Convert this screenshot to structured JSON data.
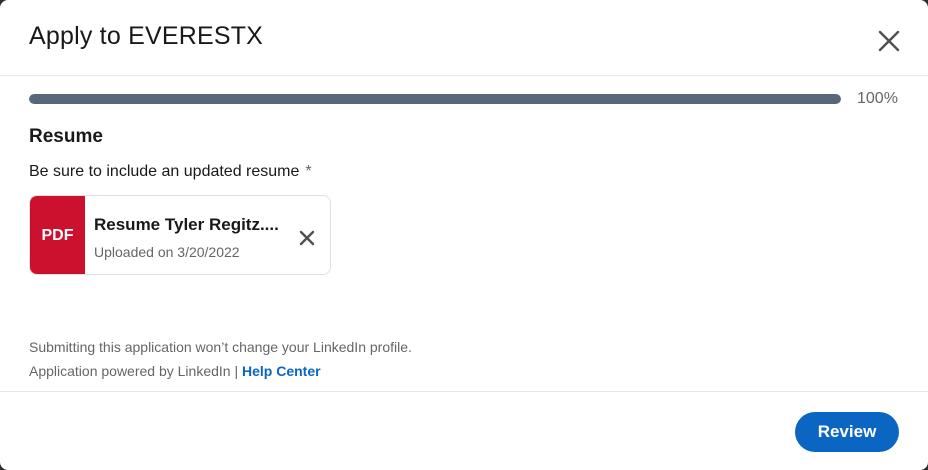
{
  "dialog": {
    "title": "Apply to EVERESTX"
  },
  "progress": {
    "value": 1.0,
    "label": "100%"
  },
  "section": {
    "title": "Resume",
    "field_label": "Be sure to include an updated resume",
    "required_marker": "*"
  },
  "file": {
    "badge": "PDF",
    "name": "Resume Tyler Regitz....",
    "meta": "Uploaded on 3/20/2022"
  },
  "footer": {
    "note": "Submitting this application won’t change your LinkedIn profile.",
    "powered_by": "Application powered by LinkedIn",
    "separator": "|",
    "help_link": "Help Center",
    "review_label": "Review"
  },
  "icons": {
    "close": "close-icon",
    "remove_file": "close-icon"
  },
  "colors": {
    "accent": "#0a66c2",
    "pdf_badge": "#cb112d",
    "progress_fill": "#56687a"
  }
}
